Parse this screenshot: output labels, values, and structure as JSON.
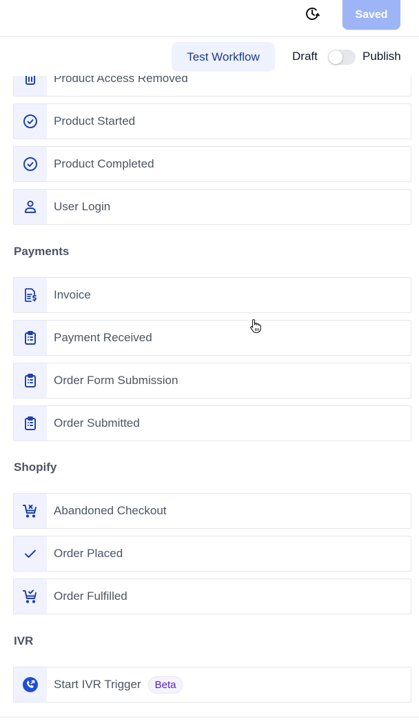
{
  "topbar": {
    "history_icon": "history-clock-icon",
    "saved_label": "Saved",
    "saved_color": "#9db4f6"
  },
  "subbar": {
    "test_workflow_label": "Test Workflow",
    "draft_label": "Draft",
    "publish_label": "Publish",
    "publish_toggle_on": false
  },
  "sections": {
    "payments": "Payments",
    "shopify": "Shopify",
    "ivr": "IVR"
  },
  "triggers": [
    {
      "label": "Product Access Removed",
      "icon": "trash-icon"
    },
    {
      "label": "Product Started",
      "icon": "check-circle-icon"
    },
    {
      "label": "Product Completed",
      "icon": "check-circle-icon"
    },
    {
      "label": "User Login",
      "icon": "user-icon"
    },
    {
      "label": "Invoice",
      "icon": "invoice-dollar-icon"
    },
    {
      "label": "Payment Received",
      "icon": "clipboard-list-icon"
    },
    {
      "label": "Order Form Submission",
      "icon": "clipboard-list-icon"
    },
    {
      "label": "Order Submitted",
      "icon": "clipboard-list-icon"
    },
    {
      "label": "Abandoned Checkout",
      "icon": "cart-x-icon"
    },
    {
      "label": "Order Placed",
      "icon": "checkmark-icon"
    },
    {
      "label": "Order Fulfilled",
      "icon": "cart-check-icon"
    },
    {
      "label": "Start IVR Trigger",
      "icon": "phone-circle-icon",
      "badge": "Beta"
    }
  ],
  "colors": {
    "icon_blue": "#1e40af",
    "icon_bg": "#f0f3fd",
    "badge_text": "#5b21b6"
  }
}
